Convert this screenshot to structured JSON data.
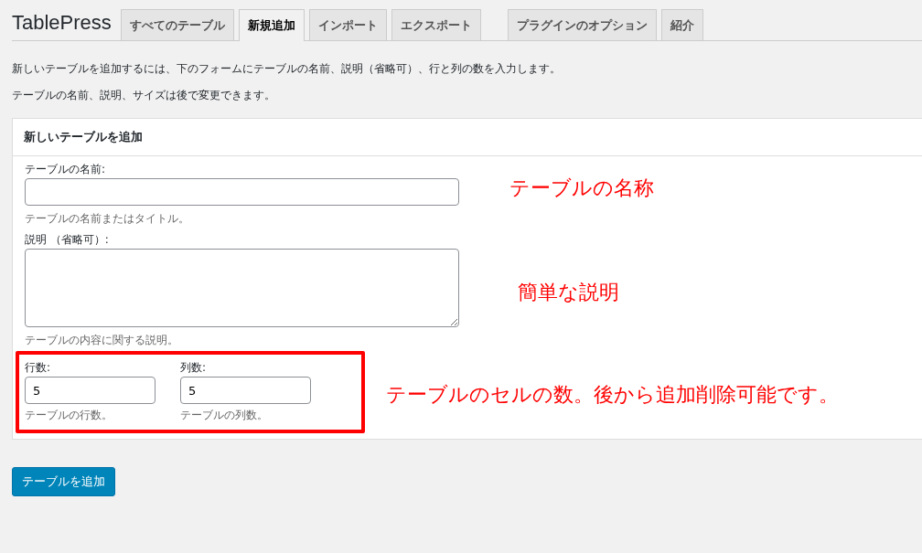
{
  "app_title": "TablePress",
  "tabs": [
    {
      "label": "すべてのテーブル",
      "selected": false
    },
    {
      "label": "新規追加",
      "selected": true
    },
    {
      "label": "インポート",
      "selected": false
    },
    {
      "label": "エクスポート",
      "selected": false
    },
    {
      "label": "プラグインのオプション",
      "selected": false
    },
    {
      "label": "紹介",
      "selected": false
    }
  ],
  "intro": [
    "新しいテーブルを追加するには、下のフォームにテーブルの名前、説明（省略可）、行と列の数を入力します。",
    "テーブルの名前、説明、サイズは後で変更できます。"
  ],
  "card": {
    "title": "新しいテーブルを追加",
    "name_field": {
      "label": "テーブルの名前:",
      "hint": "テーブルの名前またはタイトル。"
    },
    "description_field": {
      "label": "説明 （省略可）:",
      "hint": "テーブルの内容に関する説明。"
    },
    "rows_field": {
      "label": "行数:",
      "value": "5",
      "hint": "テーブルの行数。"
    },
    "columns_field": {
      "label": "列数:",
      "value": "5",
      "hint": "テーブルの列数。"
    }
  },
  "annotations": [
    "テーブルの名称",
    "簡単な説明",
    "テーブルのセルの数。後から追加削除可能です。"
  ],
  "submit_button": "テーブルを追加"
}
